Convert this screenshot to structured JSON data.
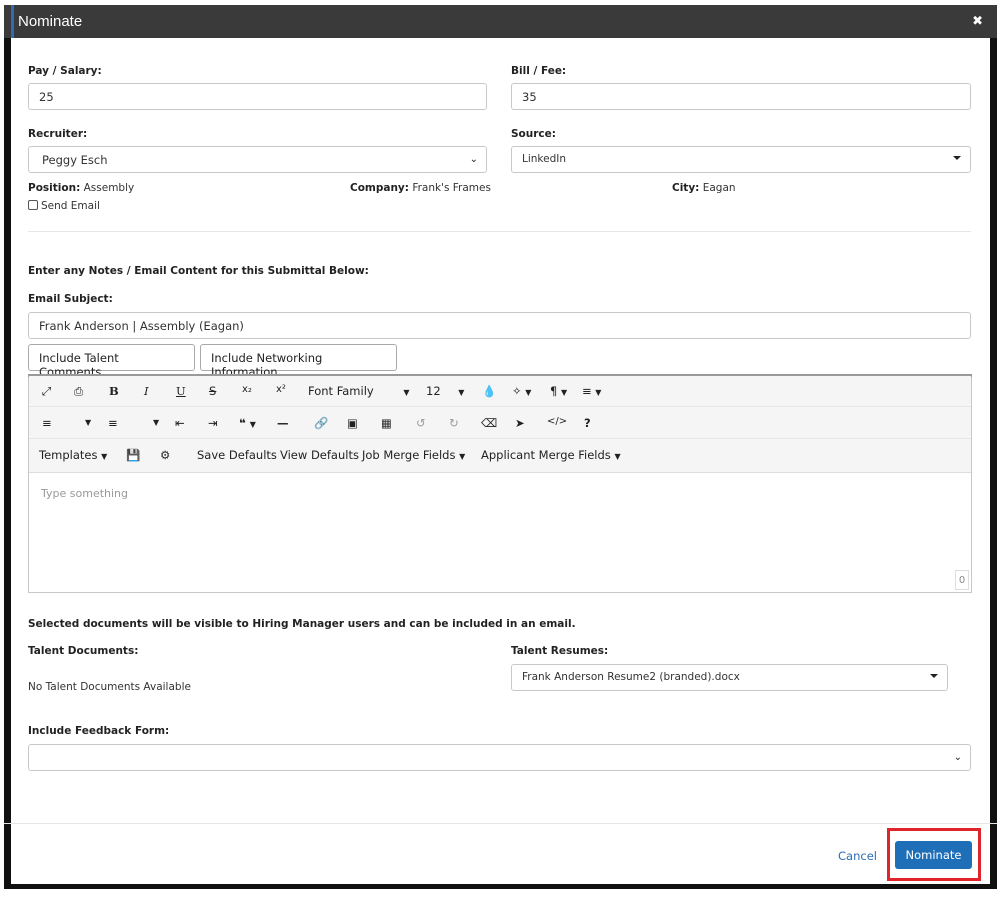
{
  "modal": {
    "title": "Nominate",
    "close_icon": "✖"
  },
  "fields": {
    "pay_label": "Pay / Salary:",
    "pay_value": "25",
    "bill_label": "Bill / Fee:",
    "bill_value": "35",
    "recruiter_label": "Recruiter:",
    "recruiter_value": "Peggy Esch",
    "source_label": "Source:",
    "source_value": "LinkedIn"
  },
  "info": {
    "position_label": "Position:",
    "position_value": "Assembly",
    "company_label": "Company:",
    "company_value": "Frank's Frames",
    "city_label": "City:",
    "city_value": "Eagan",
    "send_email_label": "Send Email"
  },
  "notes": {
    "intro": "Enter any Notes / Email Content for this Submittal Below:",
    "subject_label": "Email Subject:",
    "subject_value": "Frank Anderson | Assembly (Eagan)",
    "btn_talent_comments": "Include Talent Comments",
    "btn_networking": "Include Networking Information"
  },
  "editor": {
    "font_family": "Font Family",
    "font_size": "12",
    "templates": "Templates",
    "save_defaults": "Save Defaults",
    "view_defaults": "View Defaults",
    "job_merge": "Job Merge Fields",
    "applicant_merge": "Applicant Merge Fields",
    "placeholder": "Type something",
    "char_count": "0",
    "icons": [
      "expand-icon",
      "print-icon",
      "bold-icon",
      "italic-icon",
      "underline-icon",
      "strikethrough-icon",
      "subscript-icon",
      "superscript-icon",
      "color-icon",
      "magic-icon",
      "paragraph-icon",
      "align-icon",
      "ordered-list-icon",
      "unordered-list-icon",
      "outdent-icon",
      "indent-icon",
      "quote-icon",
      "horizontal-rule-icon",
      "link-icon",
      "image-icon",
      "table-icon",
      "undo-icon",
      "redo-icon",
      "eraser-icon",
      "select-icon",
      "code-icon",
      "help-icon",
      "save-icon",
      "gear-icon"
    ]
  },
  "documents": {
    "notice": "Selected documents will be visible to Hiring Manager users and can be included in an email.",
    "talent_docs_label": "Talent Documents:",
    "talent_docs_empty": "No Talent Documents Available",
    "resumes_label": "Talent Resumes:",
    "resume_value": "Frank Anderson Resume2 (branded).docx",
    "feedback_label": "Include Feedback Form:",
    "feedback_value": ""
  },
  "footer": {
    "cancel": "Cancel",
    "nominate": "Nominate"
  },
  "colors": {
    "primary": "#1f6fb8",
    "highlight": "#e0242c",
    "titlebar": "#3a3a3a"
  }
}
